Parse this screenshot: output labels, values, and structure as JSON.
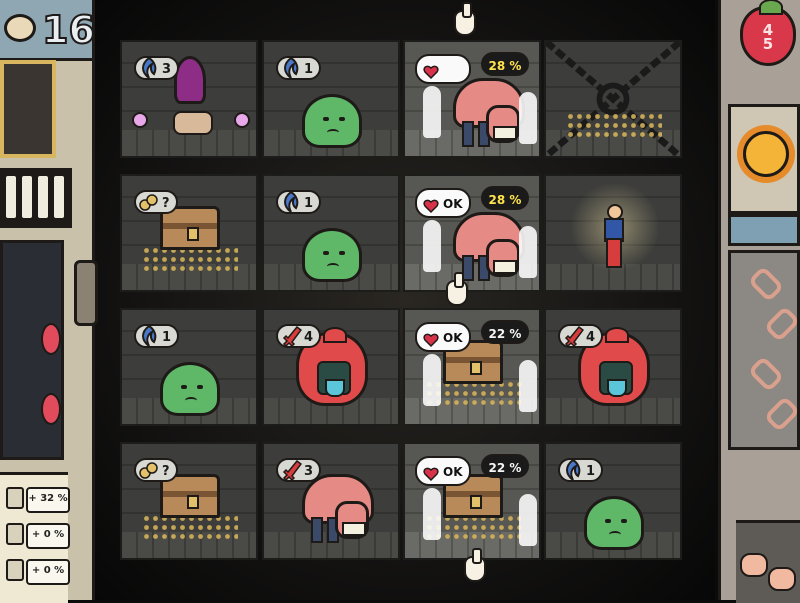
{
  "hud": {
    "level_number": "16",
    "stats": [
      "+ 32 %",
      "+ 0 %",
      "+ 0 %"
    ],
    "strawberry": {
      "num": "4",
      "den": "5"
    }
  },
  "grid": {
    "rows": [
      [
        {
          "type": "ghost-creature",
          "badge": "3",
          "badge_icon": "mana-icon"
        },
        {
          "type": "slime",
          "badge": "1",
          "badge_icon": "mana-icon"
        },
        {
          "type": "dog",
          "hp": "",
          "chance": "28 %",
          "chance_color": "#ffe34d",
          "lit": true
        },
        {
          "type": "chained"
        }
      ],
      [
        {
          "type": "chest",
          "badge": "?",
          "badge_icon": "coins-icon"
        },
        {
          "type": "slime",
          "badge": "1",
          "badge_icon": "mana-icon"
        },
        {
          "type": "dog",
          "hp": "OK",
          "chance": "28 %",
          "chance_color": "#ffe34d",
          "lit": true
        },
        {
          "type": "hero"
        }
      ],
      [
        {
          "type": "slime",
          "badge": "1",
          "badge_icon": "mana-icon"
        },
        {
          "type": "tomato",
          "badge": "4",
          "badge_icon": "sword-icon"
        },
        {
          "type": "chest",
          "hp": "OK",
          "chance": "22 %",
          "chance_color": "#f4f4f4",
          "lit": true
        },
        {
          "type": "tomato",
          "badge": "4",
          "badge_icon": "sword-icon"
        }
      ],
      [
        {
          "type": "chest",
          "badge": "?",
          "badge_icon": "coins-icon"
        },
        {
          "type": "dog",
          "badge": "3",
          "badge_icon": "sword-icon"
        },
        {
          "type": "chest",
          "hp": "OK",
          "chance": "22 %",
          "chance_color": "#f4f4f4",
          "lit": true
        },
        {
          "type": "slime",
          "badge": "1",
          "badge_icon": "mana-icon"
        }
      ]
    ]
  },
  "colors": {
    "mana": "#4a78c8",
    "sword": "#d83d3d",
    "heart": "#d8324b",
    "slime": "#5fb768",
    "tomato": "#e04a4a"
  }
}
